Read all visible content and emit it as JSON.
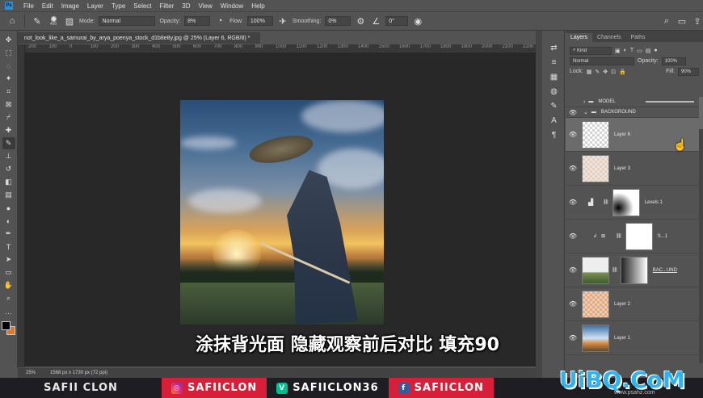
{
  "menu": {
    "logo": "Ps",
    "items": [
      "File",
      "Edit",
      "Image",
      "Layer",
      "Type",
      "Select",
      "Filter",
      "3D",
      "View",
      "Window",
      "Help"
    ]
  },
  "options": {
    "brush_size": "400",
    "mode_label": "Mode:",
    "mode_value": "Normal",
    "opacity_label": "Opacity:",
    "opacity_value": "8%",
    "flow_label": "Flow:",
    "flow_value": "100%",
    "smoothing_label": "Smoothing:",
    "smoothing_value": "0%",
    "angle_value": "0°"
  },
  "document": {
    "tab_title": "not_look_like_a_samurai_by_arya_poenya_stock_d1b8e8y.jpg @ 25% (Layer 6, RGB/8) *",
    "close": "×"
  },
  "ruler": {
    "ticks": [
      "200",
      "100",
      "0",
      "100",
      "200",
      "300",
      "400",
      "500",
      "600",
      "700",
      "800",
      "900",
      "1000",
      "1100",
      "1200",
      "1300",
      "1400",
      "1500",
      "1600",
      "1700",
      "1800",
      "1900",
      "2000",
      "2100",
      "2200"
    ]
  },
  "status": {
    "zoom": "25%",
    "doc_info": "1568 px x 1730 px (72 ppi)"
  },
  "subtitle": "涂抹背光面 隐藏观察前后对比 填充90",
  "panel": {
    "tabs": [
      "Layers",
      "Channels",
      "Paths"
    ],
    "kind_label": "Kind",
    "blend_mode": "Normal",
    "opacity_label": "Opacity:",
    "opacity_value": "100%",
    "lock_label": "Lock:",
    "fill_label": "Fill:",
    "fill_value": "90%",
    "layers": [
      {
        "name": "MODEL",
        "kind": "group"
      },
      {
        "name": "BACKGROUND",
        "kind": "group"
      },
      {
        "name": "Layer 6",
        "kind": "layer"
      },
      {
        "name": "Layer 3",
        "kind": "layer"
      },
      {
        "name": "Levels 1",
        "kind": "adjustment"
      },
      {
        "name": "S...1",
        "kind": "adjustment"
      },
      {
        "name": "BAC...UND",
        "kind": "layer"
      },
      {
        "name": "Layer 2",
        "kind": "layer"
      },
      {
        "name": "Layer 1",
        "kind": "layer"
      }
    ]
  },
  "banner": {
    "brand": "SAFII CLON",
    "instagram": "SAFIICLON",
    "vine": "SAFIICLON36",
    "facebook": "SAFIICLON"
  },
  "watermark": {
    "text": "UiBQ.CoM",
    "sub": "www.psahz.com"
  },
  "colors": {
    "foreground": "#000000",
    "background": "#e5761e",
    "accent": "#d81f3a"
  }
}
